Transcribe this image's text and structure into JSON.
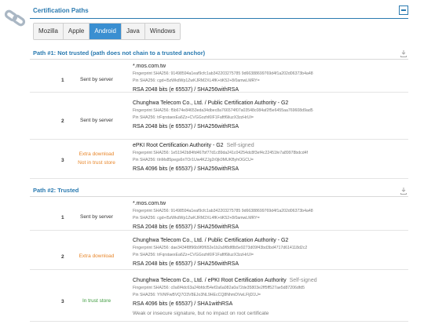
{
  "header": {
    "title": "Certification Paths"
  },
  "tabs": [
    {
      "label": "Mozilla"
    },
    {
      "label": "Apple"
    },
    {
      "label": "Android"
    },
    {
      "label": "Java"
    },
    {
      "label": "Windows"
    }
  ],
  "active_tab": "Android",
  "paths": [
    {
      "title": "Path #1: Not trusted (path does not chain to a trusted anchor)",
      "rows": [
        {
          "num": "1",
          "status": "Sent by server",
          "name": "*.mos.com.tw",
          "tag": "",
          "fingerprint": "Fingerprint SHA256: 91498594a1eaf9cfc1ab342203275785 9d66388699769d4f1a202d06373b4a48",
          "pin": "Pin SHA256: cgd+l5zWkdWp1ZwKJRM2XL4fK+tiK52+8/0amwLMRY=",
          "key": "RSA 2048 bits (e 65537) / SHA256withRSA",
          "note": ""
        },
        {
          "num": "2",
          "status": "Sent by server",
          "name": "Chunghwa Telecom Co., Ltd. / Public Certification Authority - G2",
          "tag": "",
          "fingerprint": "Fingerprint SHA256: f5b674e84653eda34dbec8a766574f07a03548c084af2f5e6455aa769608d9ad5",
          "pin": "Pin SHA256: trFqrstaexEa6Zz+CVGGozhl6IF1Faftf6iluzX3zzHrUI=",
          "key": "RSA 2048 bits (e 65537) / SHA256withRSA",
          "note": ""
        },
        {
          "num": "3",
          "status": "Extra download",
          "status2": "Not in trust store",
          "name": "ePKI Root Certification Authority - G2",
          "tag": "Self-signed",
          "fingerprint": "Fingerprint SHA256: 1e51942b84fd467bf77d1c89da241c04254dc8f3ef4c22451fe7a89978bdcd4f",
          "pin": "Pin SHA256: tlnMs85pegs6nTOr1Uw4KZJg2r0jk0MUKByhOGCU=",
          "key": "RSA 4096 bits (e 65537) / SHA256withRSA",
          "note": ""
        }
      ]
    },
    {
      "title": "Path #2: Trusted",
      "rows": [
        {
          "num": "1",
          "status": "Sent by server",
          "name": "*.mos.com.tw",
          "tag": "",
          "fingerprint": "Fingerprint SHA256: 91498594a1eaf9cfc1ab342203275785 9d66388699769d4f1a202d06373b4a48",
          "pin": "Pin SHA256: cgd+l5zWkdWp1ZwKJRM2XL4fK+tiK52+8/0amwLMRY=",
          "key": "RSA 2048 bits (e 65537) / SHA256withRSA",
          "note": ""
        },
        {
          "num": "2",
          "status": "Extra download",
          "name": "Chunghwa Telecom Co., Ltd. / Public Certification Authority - G2",
          "tag": "",
          "fingerprint": "Fingerprint SHA256: dae3434f8f96b9f0f652e1b2a9f8df8b5e9273d09f43bd3bd4717d614118d2c2",
          "pin": "Pin SHA256: trFqrstaexEa6Zz+CVGGozhl6IF1Faftf6iluzX3zzHrUI=",
          "key": "RSA 2048 bits (e 65537) / SHA256withRSA",
          "note": ""
        },
        {
          "num": "3",
          "status": "In trust store",
          "name": "Chunghwa Telecom Co., Ltd. / ePKI Root Certification Authority",
          "tag": "Self-signed",
          "fingerprint": "Fingerprint SHA256: c0a6f4dc63a24bfdcf54ef2a6a082a0a72de35803e2ff5ff527ae5d87206dfd5",
          "pin": "Pin SHA256: YlVMFwBVQ7O3V8EJo3NL9HEcCQ8NhmDVwLFljD1U=",
          "key": "RSA 4096 bits (e 65537) / SHA1withRSA",
          "note": "Weak or insecure signature, but no impact on root certificate"
        }
      ]
    }
  ],
  "colors": {
    "accent": "#2a7ab0",
    "active_tab": "#3a8fd1",
    "warning": "#e8862a",
    "success": "#3c9a3c"
  },
  "icons": {
    "left": "chain-link-icon",
    "header_button": "collapse-icon",
    "path_action": "download-icon"
  }
}
